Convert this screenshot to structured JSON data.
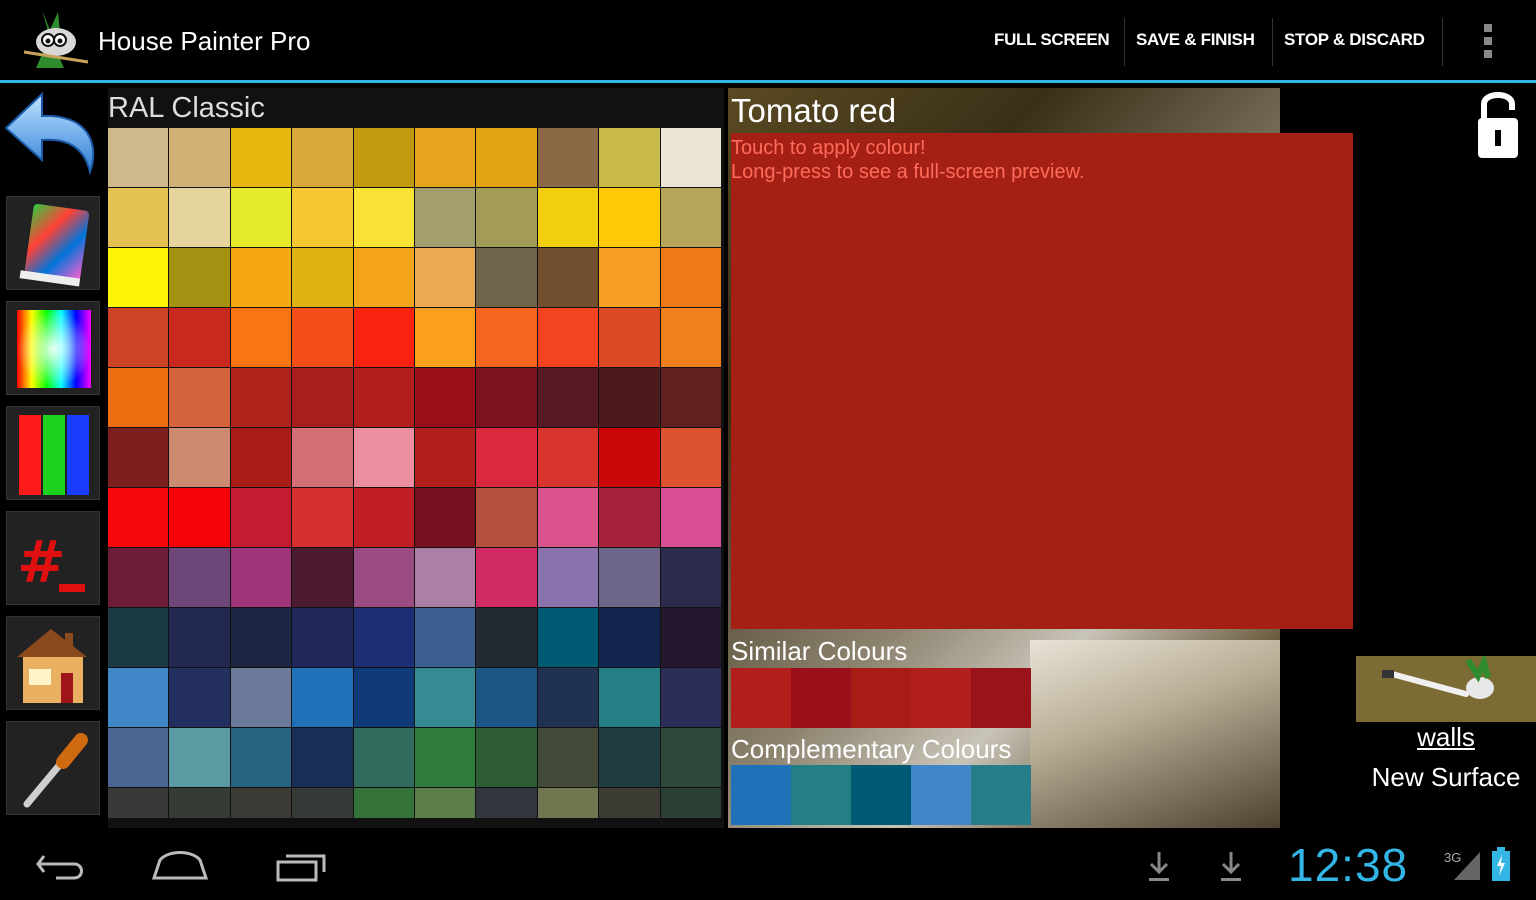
{
  "app": {
    "title": "House Painter Pro"
  },
  "actions": {
    "full_screen": "FULL SCREEN",
    "save_finish": "SAVE & FINISH",
    "stop_discard": "STOP & DISCARD"
  },
  "palette": {
    "title": "RAL Classic",
    "rows": [
      [
        "#cdb98a",
        "#d1b176",
        "#e6b80f",
        "#d8a83a",
        "#c29a0e",
        "#e8a31f",
        "#e3a414",
        "#8b6846",
        "#c8b948",
        "#ece5d3"
      ],
      [
        "#e4c251",
        "#e5d59d",
        "#e6ea2d",
        "#f5c832",
        "#f8e233",
        "#a39e6d",
        "#a39c56",
        "#f1cf0f",
        "#ffc908",
        "#b7a659"
      ],
      [
        "#fcf508",
        "#a59212",
        "#f5a714",
        "#deb211",
        "#f4a51b",
        "#ebaa53",
        "#6f6449",
        "#714f2e",
        "#f79f22",
        "#ee7a17"
      ],
      [
        "#cc4328",
        "#c8291f",
        "#f97514",
        "#f34d19",
        "#fb230f",
        "#fb9f1f",
        "#f7661f",
        "#f3441f",
        "#da4a24",
        "#f0801c"
      ],
      [
        "#ed6d10",
        "#d3643c",
        "#b0231b",
        "#a81e1d",
        "#b11e1c",
        "#9a0f1a",
        "#7a1220",
        "#571a24",
        "#4c1a1b",
        "#621f20"
      ],
      [
        "#7c1e1e",
        "#cc8a70",
        "#a71c14",
        "#d56f76",
        "#ec8ea0",
        "#b2201d",
        "#dc283c",
        "#d7352e",
        "#cc0707",
        "#dd522f"
      ],
      [
        "#f5070c",
        "#f60209",
        "#c61a33",
        "#d52f2f",
        "#c01e24",
        "#76111f",
        "#b5503e",
        "#db538d",
        "#a5233a",
        "#d94f94"
      ],
      [
        "#6c1d3a",
        "#6e4779",
        "#9f3479",
        "#4b1a2e",
        "#9a4b82",
        "#ae7fa5",
        "#d22a65",
        "#8a72ad",
        "#6c6689",
        "#2b2b4b"
      ],
      [
        "#1c3a44",
        "#222850",
        "#1c2541",
        "#20285b",
        "#1e2e74",
        "#3b608f",
        "#242a32",
        "#015a74",
        "#122650",
        "#25182e"
      ],
      [
        "#3f87c6",
        "#23305f",
        "#6c7b9a",
        "#2072b8",
        "#0f3a78",
        "#368a92",
        "#1c5687",
        "#203151",
        "#237e86",
        "#2a2e59"
      ],
      [
        "#4a6591",
        "#5a9aa2",
        "#276480",
        "#192f58",
        "#306c5e",
        "#2e7d3c",
        "#2d5c35",
        "#444a38",
        "#1e3b3f",
        "#2d4739"
      ],
      [
        "#383a38",
        "#353c34",
        "#3c3a34",
        "#353a36",
        "#33733a",
        "#5c7f4a",
        "#31373c",
        "#6f7650",
        "#3c3c35",
        "#2b3f35"
      ]
    ]
  },
  "colour": {
    "name": "Tomato red",
    "hex": "#a41f14",
    "hint1": "Touch to apply colour!",
    "hint2": "Long-press to see a full-screen preview."
  },
  "similar": {
    "title": "Similar Colours",
    "colors": [
      "#b11e1c",
      "#9a0f1a",
      "#a71c14",
      "#b2201d",
      "#9a131a"
    ]
  },
  "complementary": {
    "title": "Complementary Colours",
    "colors": [
      "#2072b8",
      "#237e86",
      "#015a74",
      "#3f87c6",
      "#267e8a"
    ]
  },
  "surface": {
    "label": "walls",
    "new_surface": "New Surface"
  },
  "status": {
    "clock": "12:38",
    "signal": "3G"
  }
}
